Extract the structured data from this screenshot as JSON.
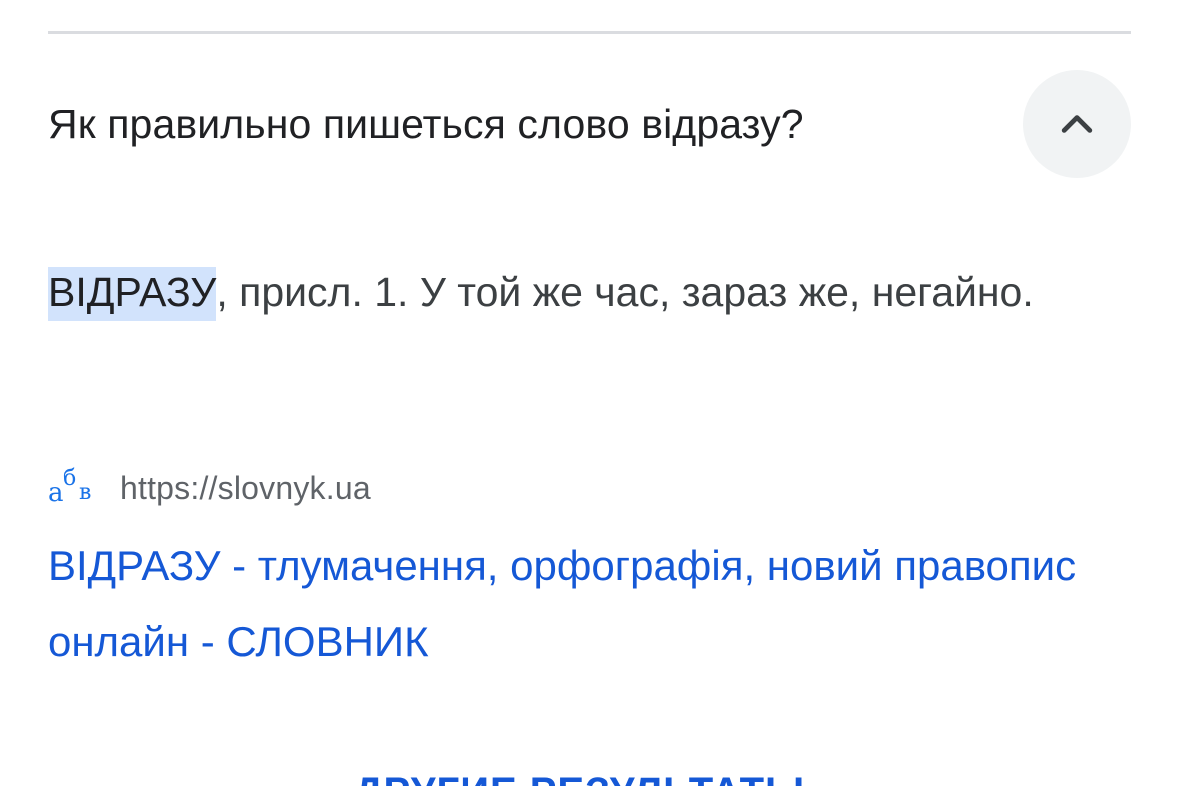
{
  "faq": {
    "question": "Як правильно пишеться слово відразу?",
    "answer_highlight": "ВІДРАЗУ",
    "answer_rest": ", присл. 1. У той же час, зараз же, негайно."
  },
  "source": {
    "favicon_letters": [
      "а",
      "б",
      "в"
    ],
    "url": "https://slovnyk.ua"
  },
  "result": {
    "title": "ВІДРАЗУ - тлумачення, орфографія, новий правопис онлайн - СЛОВНИК"
  },
  "more_results_label": "ДРУГИЕ РЕЗУЛЬТАТЫ",
  "icons": {
    "collapse": "chevron-up-icon",
    "favicon": "slovnyk-favicon-icon"
  },
  "colors": {
    "link": "#1558d6",
    "highlight": "#d2e3fc",
    "button_bg": "#f1f3f4"
  }
}
